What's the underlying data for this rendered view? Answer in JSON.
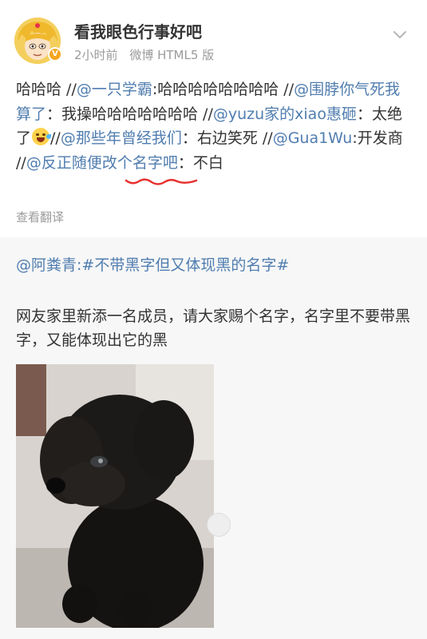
{
  "post": {
    "author": "看我眼色行事好吧",
    "time": "2小时前",
    "source": "微博 HTML5 版",
    "verified_badge": "V",
    "menu_icon": "chevron-down-icon",
    "repost_chain": [
      {
        "type": "text",
        "text": "哈哈哈 //"
      },
      {
        "type": "mention",
        "text": "@一只学霸"
      },
      {
        "type": "text",
        "text": ":哈哈哈哈哈哈哈哈 //"
      },
      {
        "type": "mention",
        "text": "@围脖你气死我算了"
      },
      {
        "type": "text",
        "text": "：我操哈哈哈哈哈哈哈 //"
      },
      {
        "type": "mention",
        "text": "@yuzu家的xiao惠砸"
      },
      {
        "type": "text",
        "text": "：太绝了"
      },
      {
        "type": "emoji",
        "name": "laughing-tears-emoji"
      },
      {
        "type": "text",
        "text": "//"
      },
      {
        "type": "mention",
        "text": "@那些年曾经我们"
      },
      {
        "type": "text",
        "text": "：右边笑死 //"
      },
      {
        "type": "mention",
        "text": "@Gua1Wu"
      },
      {
        "type": "text",
        "text": ":开发商 //"
      },
      {
        "type": "mention",
        "text": "@反正随便改个名字吧"
      },
      {
        "type": "text",
        "text": "：不白"
      }
    ],
    "translate_label": "查看翻译",
    "annotation_color": "#e8312f"
  },
  "original": {
    "author_mention": "@阿粪青",
    "hashtag": ":#不带黑字但又体现黑的名字#",
    "body": "网友家里新添一名成员，请大家赐个名字，名字里不要带黑字，又能体现出它的黑"
  },
  "colors": {
    "link": "#507daf",
    "text": "#333333",
    "meta": "#9b9b9b",
    "section_bg": "#f7f7f7"
  }
}
